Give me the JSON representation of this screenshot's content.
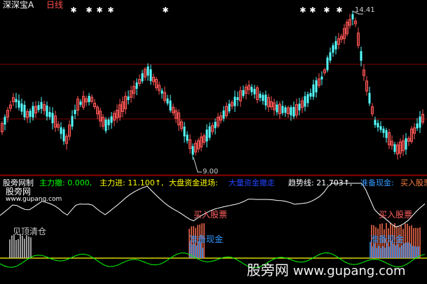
{
  "header": {
    "stock_name": "深深宝A",
    "period": "日线"
  },
  "price_panel": {
    "high_label": "14.41",
    "low_label": "9.00"
  },
  "indicator_bar": {
    "name": "股旁网制",
    "items": [
      {
        "label": "主力撤: 0.000,",
        "color": "#00ff00"
      },
      {
        "label": "主力进: 11.100↑,",
        "color": "#ffff00"
      },
      {
        "label": "大盘资金进场:",
        "color": "#ffff00"
      },
      {
        "label": "大量资金撤走",
        "color": "#0000ff"
      },
      {
        "label": "趋势线: 21.703↑,",
        "color": "#ffffff"
      },
      {
        "label": "准备现金:",
        "color": "#3399ff"
      },
      {
        "label": "买入股票",
        "color": "#ff8040"
      }
    ]
  },
  "signals": {
    "watermark_top": "股旁网",
    "watermark_url": "www.gupang.com",
    "top_clear": "见顶清仓",
    "buy_stock": "买入股票",
    "prepare_cash": "准备现金"
  },
  "footer_watermark": {
    "brand": "股旁网",
    "url": "www.gupang.com"
  },
  "colors": {
    "up_candle": "#ff5555",
    "down_candle": "#55ffff",
    "white_line": "#ffffff",
    "green_line": "#00ff00",
    "yellow_line": "#ffff00",
    "grid": "#800000"
  },
  "icons": [
    "star-marker-icon",
    "arrow-up-icon"
  ]
}
